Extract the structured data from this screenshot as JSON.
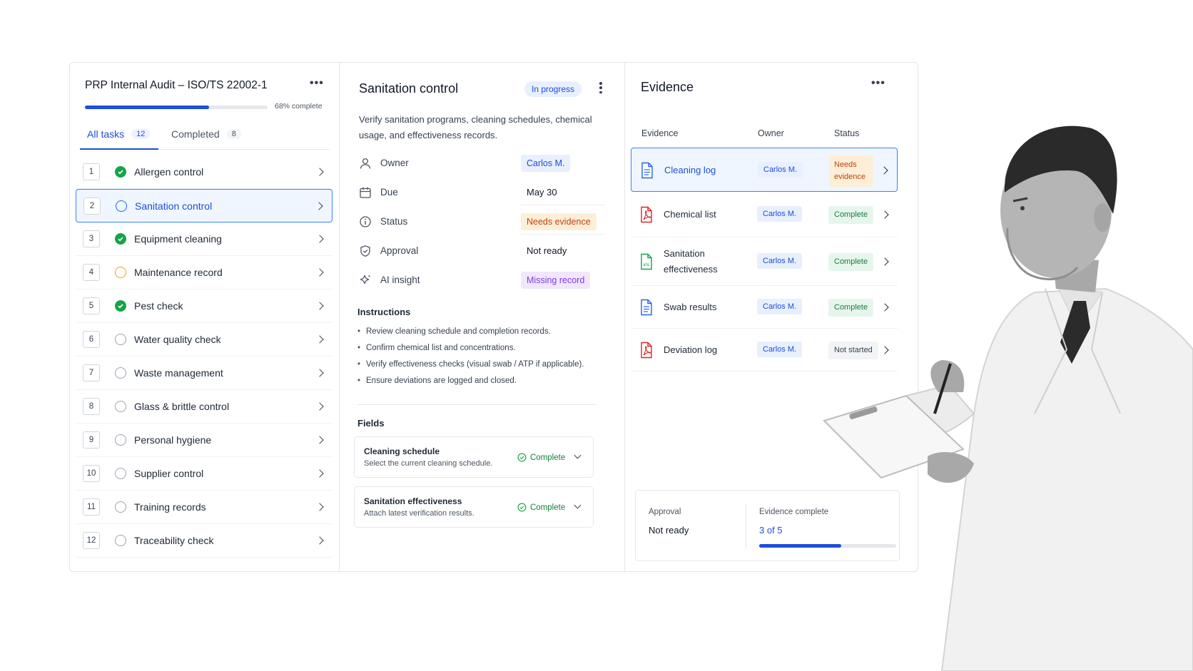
{
  "left": {
    "title": "PRP Internal Audit – ISO/TS 22002-1",
    "progress_label": "68% complete",
    "progress_value": 0.68,
    "tabs": [
      {
        "label": "All tasks",
        "count": "12"
      },
      {
        "label": "Completed",
        "count": "8"
      }
    ],
    "tasks": [
      {
        "num": "1",
        "label": "Allergen control",
        "state": "done"
      },
      {
        "num": "2",
        "label": "Sanitation control",
        "state": "active"
      },
      {
        "num": "3",
        "label": "Equipment cleaning",
        "state": "done"
      },
      {
        "num": "4",
        "label": "Maintenance record",
        "state": "warn"
      },
      {
        "num": "5",
        "label": "Pest check",
        "state": "done"
      },
      {
        "num": "6",
        "label": "Water quality check",
        "state": "todo"
      },
      {
        "num": "7",
        "label": "Waste management",
        "state": "todo"
      },
      {
        "num": "8",
        "label": "Glass & brittle control",
        "state": "todo"
      },
      {
        "num": "9",
        "label": "Personal hygiene",
        "state": "todo"
      },
      {
        "num": "10",
        "label": "Supplier control",
        "state": "todo"
      },
      {
        "num": "11",
        "label": "Training records",
        "state": "todo"
      },
      {
        "num": "12",
        "label": "Traceability check",
        "state": "todo"
      }
    ]
  },
  "middle": {
    "title": "Sanitation control",
    "status_badge": "In progress",
    "description": "Verify sanitation programs, cleaning schedules, chemical usage, and effectiveness records.",
    "meta": {
      "owner_label": "Owner",
      "owner_value": "Carlos M.",
      "due_label": "Due",
      "due_value": "May 30",
      "status_label": "Status",
      "status_value": "Needs evidence",
      "approval_label": "Approval",
      "approval_value": "Not ready",
      "ai_label": "AI insight",
      "ai_value": "Missing record"
    },
    "instructions_title": "Instructions",
    "instructions": [
      "Review cleaning schedule and completion records.",
      "Confirm chemical list and concentrations.",
      "Verify effectiveness checks (visual swab / ATP if applicable).",
      "Ensure deviations are logged and closed."
    ],
    "fields_title": "Fields",
    "fields": [
      {
        "title": "Cleaning schedule",
        "subtitle": "Select the current cleaning schedule.",
        "status": "Complete"
      },
      {
        "title": "Sanitation effectiveness",
        "subtitle": "Attach latest verification results.",
        "status": "Complete"
      }
    ]
  },
  "right": {
    "title": "Evidence",
    "columns": [
      "Evidence",
      "Owner",
      "Status"
    ],
    "rows": [
      {
        "name": "Cleaning log",
        "owner": "Carlos M.",
        "status": "Needs evidence",
        "icon": "doc-icon",
        "tone": "orange"
      },
      {
        "name": "Chemical list",
        "owner": "Carlos M.",
        "status": "Complete",
        "icon": "pdf-icon",
        "tone": "green"
      },
      {
        "name": "Sanitation effectiveness",
        "owner": "Carlos M.",
        "status": "Complete",
        "icon": "xls-icon",
        "tone": "green"
      },
      {
        "name": "Swab results",
        "owner": "Carlos M.",
        "status": "Complete",
        "icon": "doc-icon",
        "tone": "green"
      },
      {
        "name": "Deviation log",
        "owner": "Carlos M.",
        "status": "Not started",
        "icon": "pdf-icon",
        "tone": "gray"
      }
    ],
    "summary": {
      "approval_label": "Approval",
      "approval_value": "Not ready",
      "evidence_label": "Evidence complete",
      "evidence_value": "3 of 5",
      "evidence_fraction": 0.6
    }
  },
  "colors": {
    "accent": "#1d4ed8",
    "success": "#16a34a",
    "warning": "#f59e0b",
    "ai": "#7c3aed"
  }
}
